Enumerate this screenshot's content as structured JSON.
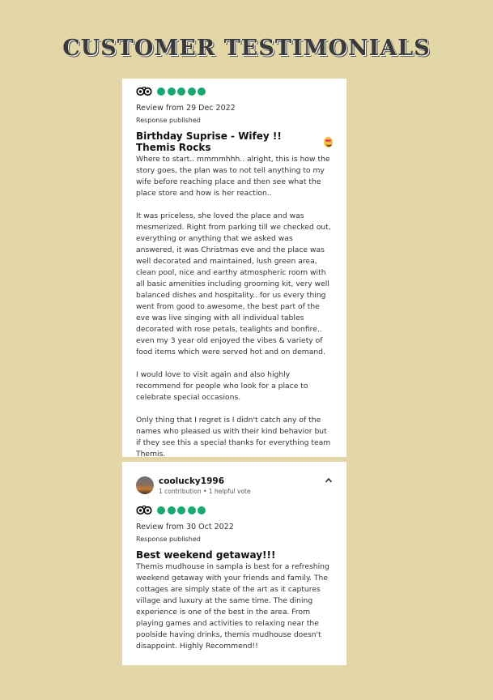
{
  "page": {
    "title": "CUSTOMER TESTIMONIALS"
  },
  "colors": {
    "background": "#e3d6a7",
    "rating_green": "#16a971",
    "card": "#ffffff"
  },
  "reviews": [
    {
      "rating": 5,
      "date": "Review from 29 Dec 2022",
      "status": "Response published",
      "title": "Birthday Suprise - Wifey !! Themis Rocks",
      "title_emoji": "smiling-face-with-heart-eyes",
      "paragraphs": [
        "Where to start.. mmmmhhh.. alright, this is how the story goes, the plan was to not tell anything to my wife before reaching place and then see what the place store and how is her reaction..",
        "It was priceless, she loved the place and was mesmerized. Right from parking till we checked out, everything or anything that we asked was answered, it was Christmas eve and the place was well decorated and maintained, lush green area, clean pool, nice and earthy atmospheric room with all basic amenities including grooming kit, very well balanced dishes and hospitality.. for us every thing went from good to awesome, the best part of the eve was live singing with all individual tables decorated with rose petals, tealights and bonfire.. even my 3 year old enjoyed the vibes & variety of food items which were served hot and on demand.",
        "I would love to visit again and also highly recommend for people who look for a place to celebrate special occasions.",
        "Only thing that I regret is I didn't catch any of the names who pleased us with their kind behavior but if they see this a special thanks for everything team Themis."
      ]
    },
    {
      "user": {
        "name": "coolucky1996",
        "stats": "1 contribution • 1 helpful vote"
      },
      "rating": 5,
      "date": "Review from 30 Oct 2022",
      "status": "Response published",
      "title": "Best weekend getaway!!!",
      "paragraphs": [
        "Themis mudhouse in sampla is best for a refreshing weekend getaway with your friends and family. The cottages are simply state of the art as it captures village and luxury at the same time. The dining experience is one of the best in the area. From playing games and activities to relaxing near the poolside having drinks, themis mudhouse doesn't disappoint. Highly Recommend!!"
      ]
    }
  ]
}
